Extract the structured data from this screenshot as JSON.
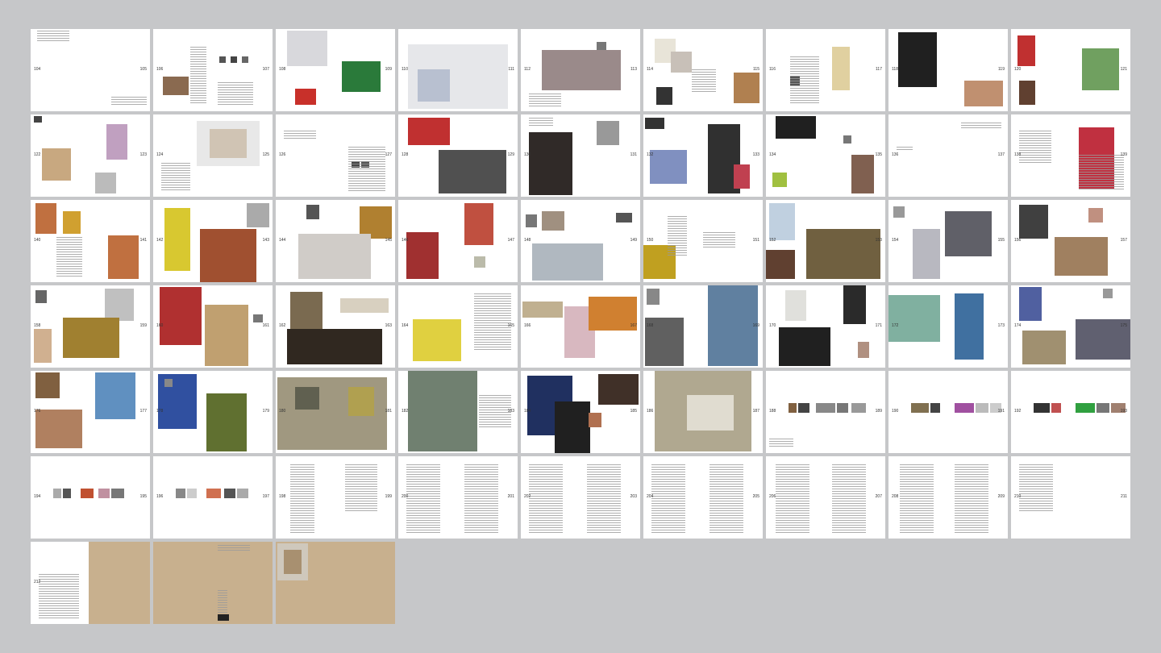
{
  "view": "book spreads overview",
  "spreads": [
    {
      "left": "104",
      "right": "105"
    },
    {
      "left": "106",
      "right": "107"
    },
    {
      "left": "108",
      "right": "109"
    },
    {
      "left": "110",
      "right": "111"
    },
    {
      "left": "112",
      "right": "113"
    },
    {
      "left": "114",
      "right": "115"
    },
    {
      "left": "116",
      "right": "117"
    },
    {
      "left": "118",
      "right": "119"
    },
    {
      "left": "120",
      "right": "121"
    },
    {
      "left": "122",
      "right": "123"
    },
    {
      "left": "124",
      "right": "125"
    },
    {
      "left": "126",
      "right": "127"
    },
    {
      "left": "128",
      "right": "129"
    },
    {
      "left": "130",
      "right": "131"
    },
    {
      "left": "132",
      "right": "133"
    },
    {
      "left": "134",
      "right": "135"
    },
    {
      "left": "136",
      "right": "137"
    },
    {
      "left": "138",
      "right": "139"
    },
    {
      "left": "140",
      "right": "141"
    },
    {
      "left": "142",
      "right": "143"
    },
    {
      "left": "144",
      "right": "145"
    },
    {
      "left": "146",
      "right": "147"
    },
    {
      "left": "148",
      "right": "149"
    },
    {
      "left": "150",
      "right": "151"
    },
    {
      "left": "152",
      "right": "153"
    },
    {
      "left": "154",
      "right": "155"
    },
    {
      "left": "156",
      "right": "157"
    },
    {
      "left": "158",
      "right": "159"
    },
    {
      "left": "160",
      "right": "161"
    },
    {
      "left": "162",
      "right": "163"
    },
    {
      "left": "164",
      "right": "165"
    },
    {
      "left": "166",
      "right": "167"
    },
    {
      "left": "168",
      "right": "169"
    },
    {
      "left": "170",
      "right": "171"
    },
    {
      "left": "172",
      "right": "173"
    },
    {
      "left": "174",
      "right": "175"
    },
    {
      "left": "176",
      "right": "177"
    },
    {
      "left": "178",
      "right": "179"
    },
    {
      "left": "180",
      "right": "181"
    },
    {
      "left": "182",
      "right": "183"
    },
    {
      "left": "184",
      "right": "185"
    },
    {
      "left": "186",
      "right": "187"
    },
    {
      "left": "188",
      "right": "189"
    },
    {
      "left": "190",
      "right": "191"
    },
    {
      "left": "192",
      "right": "193"
    },
    {
      "left": "194",
      "right": "195"
    },
    {
      "left": "196",
      "right": "197"
    },
    {
      "left": "198",
      "right": "199"
    },
    {
      "left": "200",
      "right": "201"
    },
    {
      "left": "202",
      "right": "203"
    },
    {
      "left": "204",
      "right": "205"
    },
    {
      "left": "206",
      "right": "207"
    },
    {
      "left": "208",
      "right": "209"
    },
    {
      "left": "210",
      "right": "211"
    },
    {
      "left": "212",
      "right": ""
    },
    {
      "left": "",
      "right": ""
    },
    {
      "left": "",
      "right": ""
    }
  ],
  "colors": {
    "background": "#c6c7c9",
    "page": "#ffffff",
    "cover": "#c8b08e"
  }
}
